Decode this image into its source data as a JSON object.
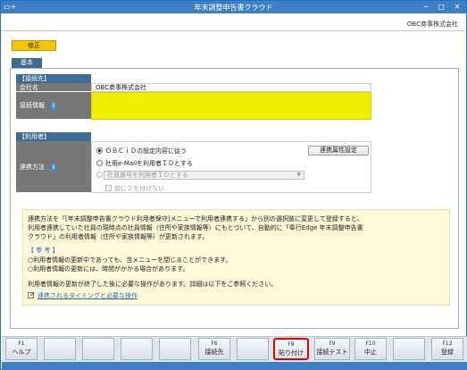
{
  "window": {
    "title": "年末調整申告書クラウド",
    "app_icon": "+",
    "minimize": "─",
    "maximize": "□",
    "close": "✕"
  },
  "header": {
    "company": "OBC商事株式会社"
  },
  "mode_badge": "修正",
  "tab": "基本",
  "connection": {
    "section_label": "【接続先】",
    "company_label": "会社名",
    "company_value": "OBC商事株式会社",
    "info_label": "接続情報"
  },
  "user_info": {
    "section_label": "【利用者】",
    "method_label": "連携方法",
    "options": [
      "ＯＢＣｉＤの設定内容に従う",
      "社用e-Mailを利用者ＩＤとする",
      "社員番号を利用者ＩＤとする"
    ],
    "checkbox_label": "前に０を付けない",
    "attr_button": "連携属性設定"
  },
  "notice": {
    "lines": [
      "連携方法を「[年末調整申告書クラウド利用者保守]メニューで利用者連携する」から別の選択肢に変更して登録すると、",
      "利用者連携していた社員の現時点の社員情報（住所や家族情報等）にもとづいて、自動的に「奉行Edge 年末調整申告書",
      "クラウド」の利用者情報（住所や家族情報等）が更新されます。"
    ],
    "ref_title": "【 参 考 】",
    "refs": [
      "○利用者情報の更新中であっても、当メニューを閉じることができます。",
      "○利用者情報の更新には、時間がかかる場合があります。"
    ],
    "after": "利用者情報の更新が終了した後に必要な操作があります。詳細は以下をご参照ください。",
    "link": "連携されるタイミングと必要な操作"
  },
  "fkeys": [
    {
      "key": "F1",
      "label": "ヘルプ"
    },
    {
      "key": "",
      "label": ""
    },
    {
      "key": "",
      "label": ""
    },
    {
      "key": "",
      "label": ""
    },
    {
      "key": "",
      "label": ""
    },
    {
      "key": "F6",
      "label": "接続先"
    },
    {
      "key": "",
      "label": ""
    },
    {
      "key": "F8",
      "label": "貼り付け"
    },
    {
      "key": "F9",
      "label": "接続テスト"
    },
    {
      "key": "F10",
      "label": "中止"
    },
    {
      "key": "",
      "label": ""
    },
    {
      "key": "F12",
      "label": "登録"
    }
  ],
  "colors": {
    "titlebar": "#3d7fc4",
    "badge": "#f6c400",
    "highlight": "#f2ee00",
    "active_key_border": "#e60000"
  }
}
